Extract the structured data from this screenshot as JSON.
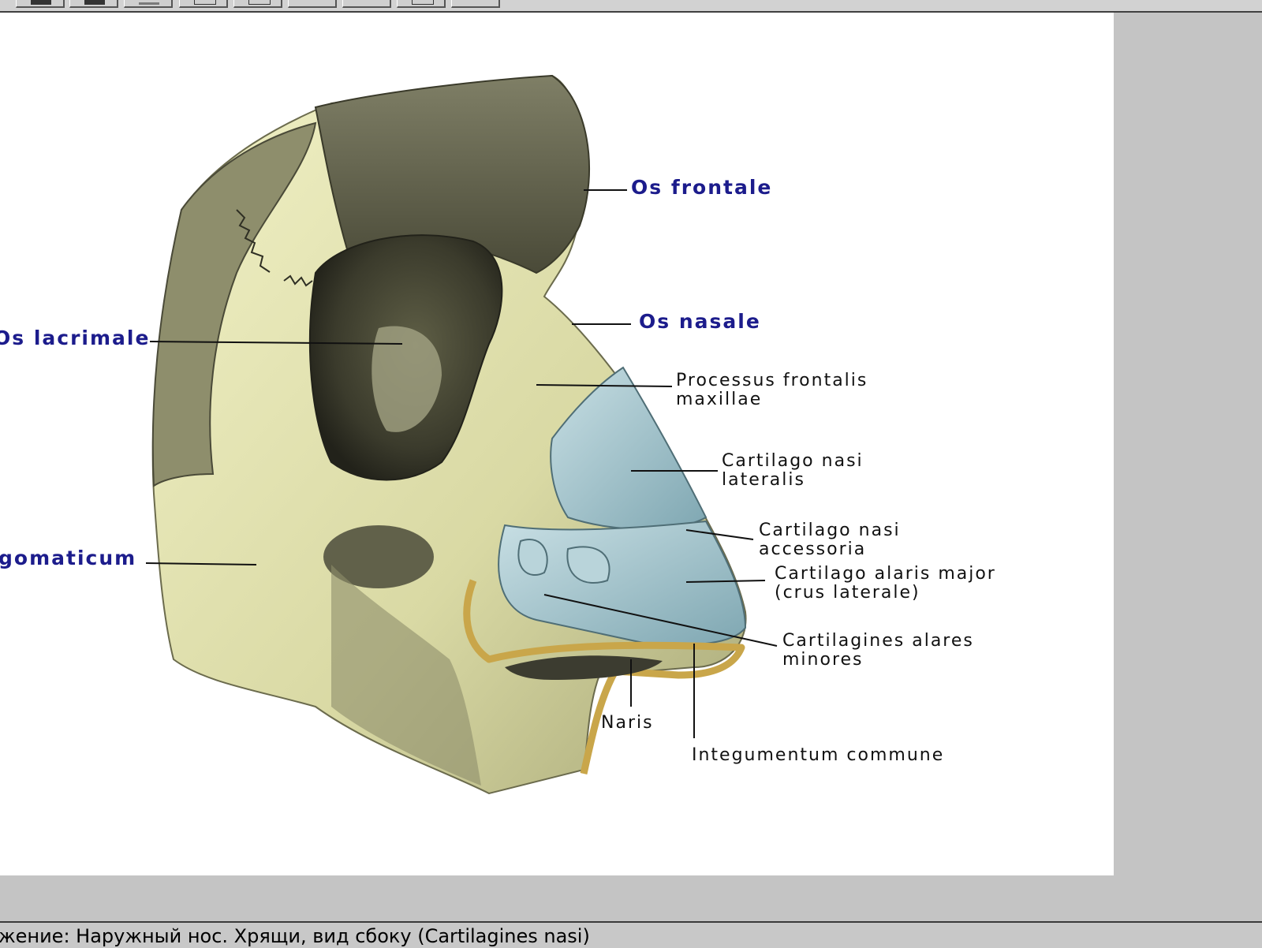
{
  "toolbar": {
    "buttons": [
      "tool-1",
      "tool-2",
      "tool-3",
      "tool-4",
      "tool-5",
      "tool-6",
      "tool-7",
      "tool-8",
      "tool-9"
    ]
  },
  "figure": {
    "labels": {
      "os_frontale": "Os frontale",
      "os_nasale": "Os nasale",
      "os_lacrimale": "Os lacrimale",
      "os_zygomaticum": "gomaticum",
      "processus_frontalis": [
        "Processus frontalis",
        "maxillae"
      ],
      "cartilago_lateralis": [
        "Cartilago nasi",
        "lateralis"
      ],
      "cartilago_accessoria": [
        "Cartilago nasi",
        "accessoria"
      ],
      "cartilago_alaris_major": [
        "Cartilago alaris major",
        "(crus laterale)"
      ],
      "cartilagines_alares": [
        "Cartilagines alares",
        "minores"
      ],
      "naris": "Naris",
      "integumentum": "Integumentum commune"
    },
    "colors": {
      "bone_label": "#1c1c8c",
      "bone": "#e6e6b4",
      "cartilage": "#a6cbd3"
    }
  },
  "statusbar": {
    "text": "жение: Наружный нос. Хрящи, вид сбоку (Cartilagines nasi)"
  }
}
